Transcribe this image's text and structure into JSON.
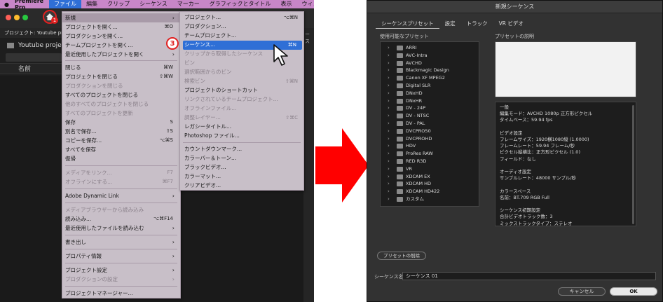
{
  "menubar": {
    "app_name": "Premiere Pro",
    "items": [
      "ファイル",
      "編集",
      "クリップ",
      "シーケンス",
      "マーカー",
      "グラフィックとタイトル",
      "表示",
      "ウィンドウ"
    ]
  },
  "project": {
    "bar_title": "プロジェクト: Youtube project",
    "name": "Youtube project.",
    "column_name": "名前",
    "right_tab": "ース"
  },
  "annotations": {
    "step1": "1",
    "step3": "3"
  },
  "file_menu": {
    "new": "新規",
    "open_project": "プロジェクトを開く...",
    "open_project_sc": "⌘O",
    "open_production": "プロダクションを開く...",
    "open_team_project": "チームプロジェクトを開く...",
    "recent_projects": "最近使用したプロジェクトを開く",
    "close": "閉じる",
    "close_sc": "⌘W",
    "close_project": "プロジェクトを閉じる",
    "close_project_sc": "⇧⌘W",
    "close_production": "プロダクションを閉じる",
    "close_all_projects": "すべてのプロジェクトを閉じる",
    "close_other_projects": "他のすべてのプロジェクトを閉じる",
    "refresh_all_projects": "すべてのプロジェクトを更新",
    "save": "保存",
    "save_sc": "S",
    "save_as": "別名で保存...",
    "save_as_sc": "⇧S",
    "save_copy": "コピーを保存...",
    "save_copy_sc": "⌥⌘S",
    "save_all": "すべてを保存",
    "revert": "復帰",
    "link_media": "メディアをリンク...",
    "link_media_sc": "F7",
    "make_offline": "オフラインにする...",
    "make_offline_sc": "⌘F7",
    "adobe_dynamic_link": "Adobe Dynamic Link",
    "import_from_browser": "メディアブラウザーから読み込み",
    "import_from_browser_sc": "⌥⌘F14",
    "import": "読み込み...",
    "import_sc": "⌘I",
    "import_recent": "最近使用したファイルを読み込む",
    "export": "書き出し",
    "properties": "プロパティ情報",
    "project_settings": "プロジェクト設定",
    "production_settings": "プロダクションの設定",
    "project_manager": "プロジェクトマネージャー..."
  },
  "submenu": {
    "project": "プロジェクト...",
    "project_sc": "⌥⌘N",
    "production": "プロダクション...",
    "team_project": "チームプロジェクト...",
    "sequence": "シーケンス...",
    "sequence_sc": "⌘N",
    "sequence_from_clip": "クリップから取得したシーケンス",
    "bin": "ビン",
    "bin_from_selection": "選択範囲からのビン",
    "search_bin": "検索ビン",
    "search_bin_sc": "⇧⌘N",
    "project_shortcut": "プロジェクトのショートカット",
    "linked_team_project": "リンクされているチームプロジェクト...",
    "offline_file": "オフラインファイル...",
    "adjustment_layer": "調整レイヤー...",
    "adjustment_layer_sc": "⇧⌘C",
    "legacy_title": "レガシータイトル...",
    "photoshop_file": "Photoshop ファイル...",
    "countdown": "カウントダウンマーク...",
    "bars_tone": "カラーバー＆トーン...",
    "black_video": "ブラックビデオ...",
    "color_matte": "カラーマット...",
    "transparent_video": "クリアビデオ..."
  },
  "dialog": {
    "title": "新規シーケンス",
    "tabs": [
      "シーケンスプリセット",
      "設定",
      "トラック",
      "VR ビデオ"
    ],
    "available_presets_label": "使用可能なプリセット",
    "preset_description_label": "プリセットの説明",
    "presets": [
      "ARRI",
      "AVC-Intra",
      "AVCHD",
      "Blackmagic Design",
      "Canon XF MPEG2",
      "Digital SLR",
      "DNxHD",
      "DNxHR",
      "DV - 24P",
      "DV - NTSC",
      "DV - PAL",
      "DVCPRO50",
      "DVCPROHD",
      "HDV",
      "ProRes RAW",
      "RED R3D",
      "VR",
      "XDCAM EX",
      "XDCAM HD",
      "XDCAM HD422",
      "カスタム"
    ],
    "details": [
      "一般",
      "編集モード：AVCHD 1080p 正方形ピクセル",
      "タイムベース：59.94 fps",
      "",
      "ビデオ設定",
      "フレームサイズ：1920横1080縦 (1.0000)",
      "フレームレート：59.94 フレーム/秒",
      "ピクセル縦横比：正方形ピクセル (1.0)",
      "フィールド：なし",
      "",
      "オーディオ設定",
      "サンプルレート：48000 サンプル/秒",
      "",
      "カラースペース",
      "名前：BT.709 RGB Full",
      "",
      "シーケンス初期設定",
      "合計ビデオトラック数：3",
      "ミックストラックタイプ：ステレオ"
    ],
    "delete_preset": "プリセットの削除",
    "sequence_name_label": "シーケンス名：",
    "sequence_name_value": "シーケンス 01",
    "cancel": "キャンセル",
    "ok": "OK"
  },
  "colors": {
    "menubar_bg": "#c886c8",
    "menu_bg": "#c8bfc8",
    "highlight_blue": "#2f6fd6",
    "annotation_red": "#e02020"
  }
}
